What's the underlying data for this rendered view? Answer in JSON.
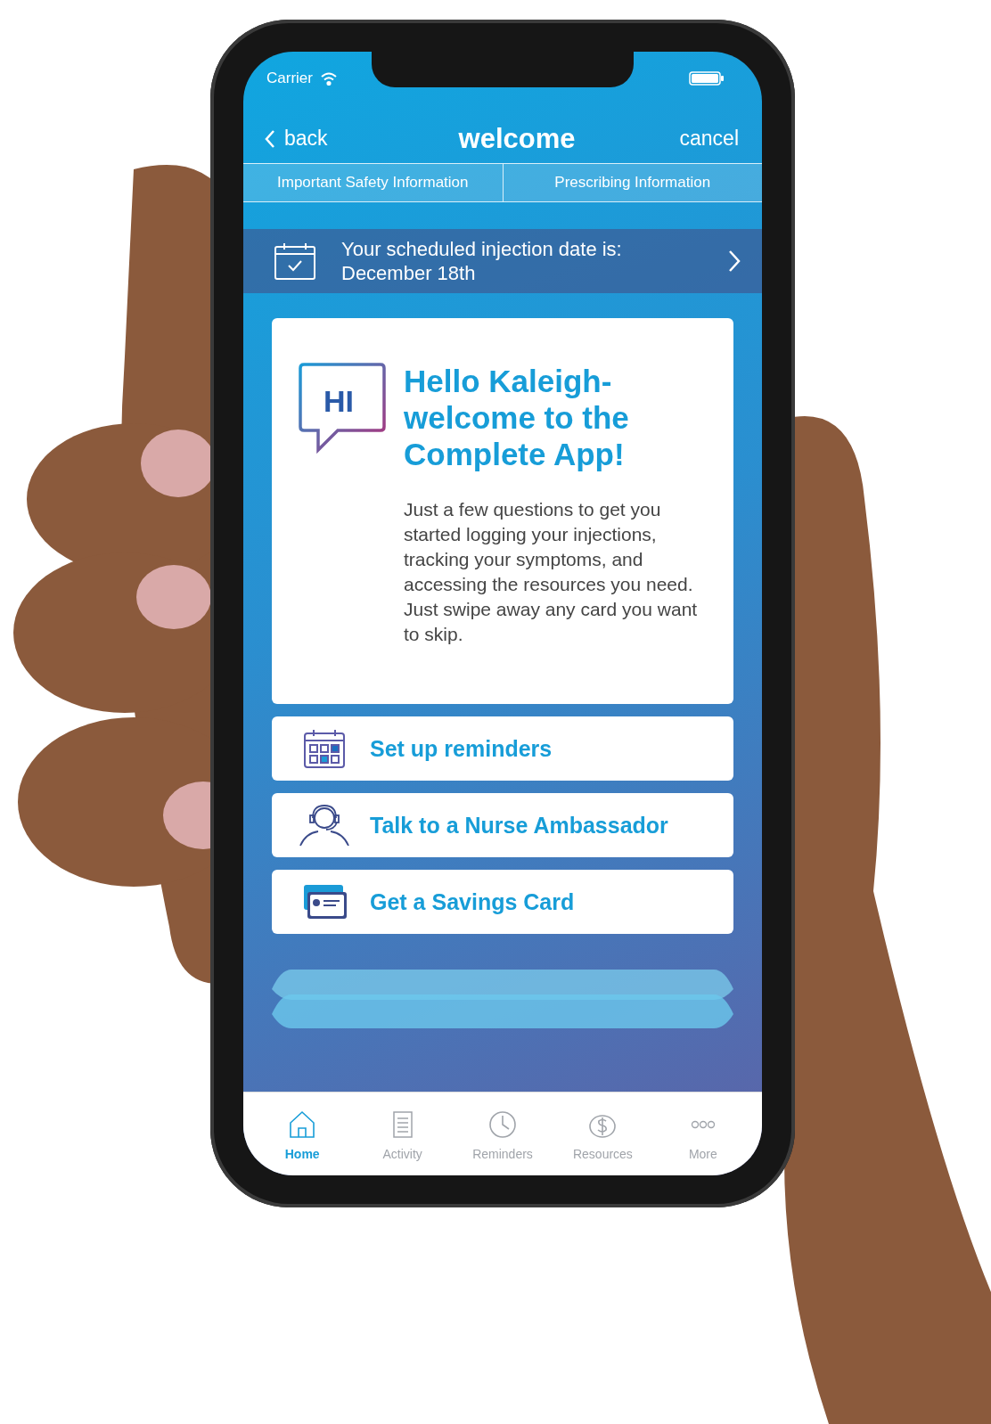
{
  "status_bar": {
    "carrier": "Carrier"
  },
  "nav": {
    "back": "back",
    "title": "welcome",
    "cancel": "cancel"
  },
  "info_tabs": [
    {
      "label": "Important Safety Information"
    },
    {
      "label": "Prescribing Information"
    }
  ],
  "banner": {
    "text": "Your scheduled injection date is:\nDecember 18th"
  },
  "welcome_card": {
    "badge": "HI",
    "heading": "Hello Kaleigh-\nwelcome to the\nComplete App!",
    "body": "Just a few questions to get you started logging your injections, tracking your symptoms, and accessing the resources you need. Just swipe away any card you want to skip."
  },
  "actions": [
    {
      "kind": "calendar",
      "label": "Set up reminders"
    },
    {
      "kind": "nurse",
      "label": "Talk to a Nurse Ambassador"
    },
    {
      "kind": "card",
      "label": "Get a Savings Card"
    }
  ],
  "tab_bar": [
    {
      "kind": "home",
      "label": "Home",
      "selected": true
    },
    {
      "kind": "activity",
      "label": "Activity",
      "selected": false
    },
    {
      "kind": "reminders",
      "label": "Reminders",
      "selected": false
    },
    {
      "kind": "resources",
      "label": "Resources",
      "selected": false
    },
    {
      "kind": "more",
      "label": "More",
      "selected": false
    }
  ]
}
